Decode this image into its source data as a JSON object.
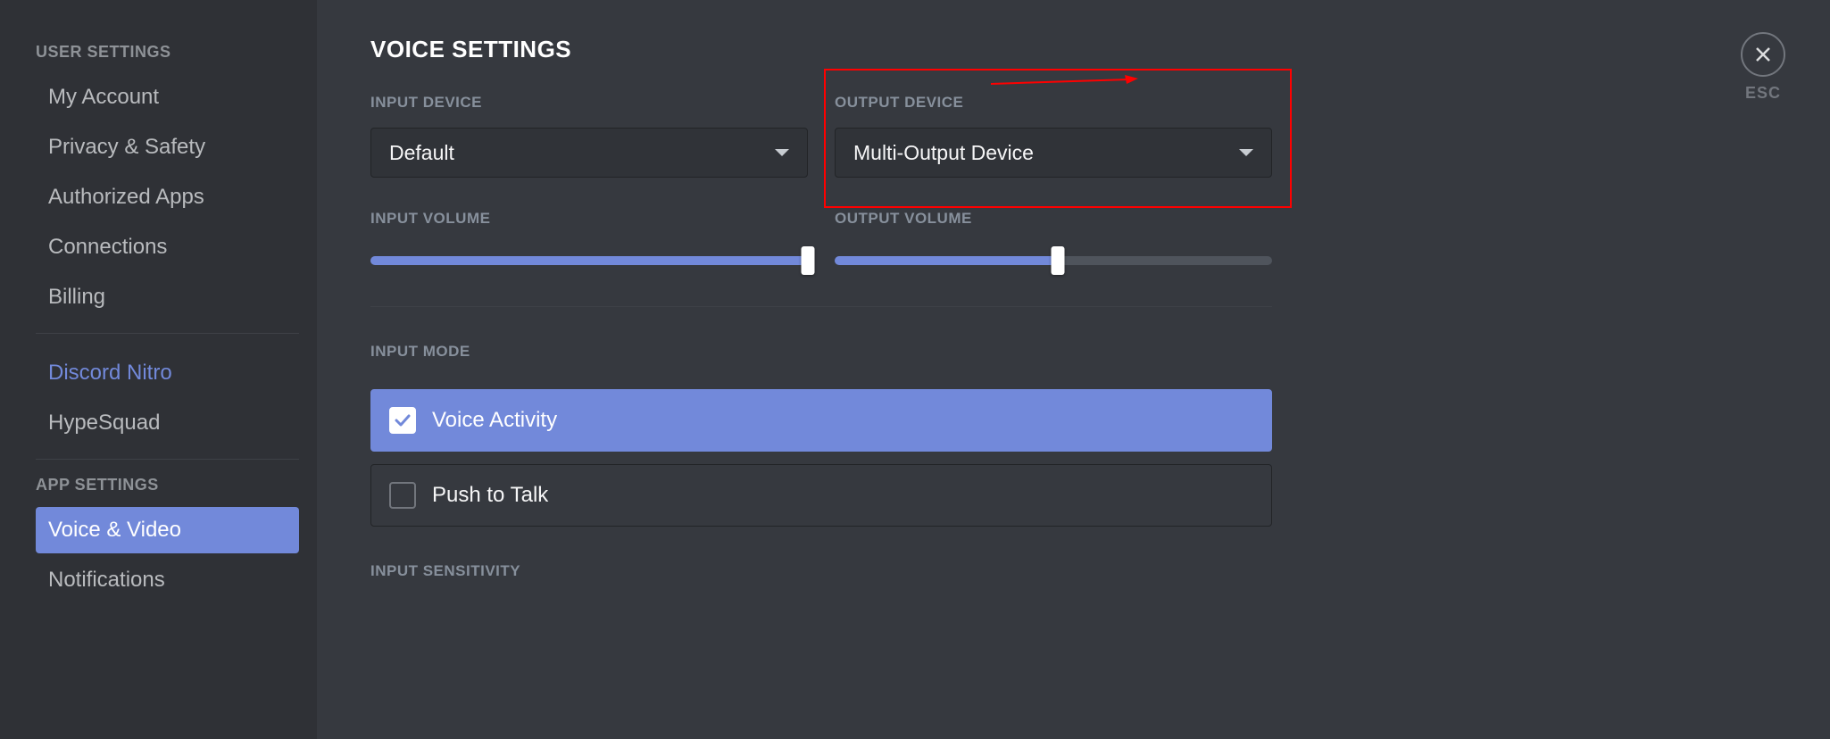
{
  "sidebar": {
    "categories": [
      {
        "label": "USER SETTINGS",
        "items": [
          {
            "label": "My Account",
            "type": "normal"
          },
          {
            "label": "Privacy & Safety",
            "type": "normal"
          },
          {
            "label": "Authorized Apps",
            "type": "normal"
          },
          {
            "label": "Connections",
            "type": "normal"
          },
          {
            "label": "Billing",
            "type": "normal"
          }
        ]
      },
      {
        "items": [
          {
            "label": "Discord Nitro",
            "type": "nitro"
          },
          {
            "label": "HypeSquad",
            "type": "normal"
          }
        ]
      },
      {
        "label": "APP SETTINGS",
        "items": [
          {
            "label": "Voice & Video",
            "type": "active"
          },
          {
            "label": "Notifications",
            "type": "normal"
          }
        ]
      }
    ]
  },
  "page": {
    "title": "VOICE SETTINGS",
    "input_device_label": "INPUT DEVICE",
    "input_device_value": "Default",
    "output_device_label": "OUTPUT DEVICE",
    "output_device_value": "Multi-Output Device",
    "input_volume_label": "INPUT VOLUME",
    "input_volume_percent": 100,
    "output_volume_label": "OUTPUT VOLUME",
    "output_volume_percent": 51,
    "input_mode_label": "INPUT MODE",
    "modes": [
      {
        "label": "Voice Activity",
        "selected": true
      },
      {
        "label": "Push to Talk",
        "selected": false
      }
    ],
    "input_sensitivity_label": "INPUT SENSITIVITY"
  },
  "close": {
    "esc": "ESC"
  }
}
